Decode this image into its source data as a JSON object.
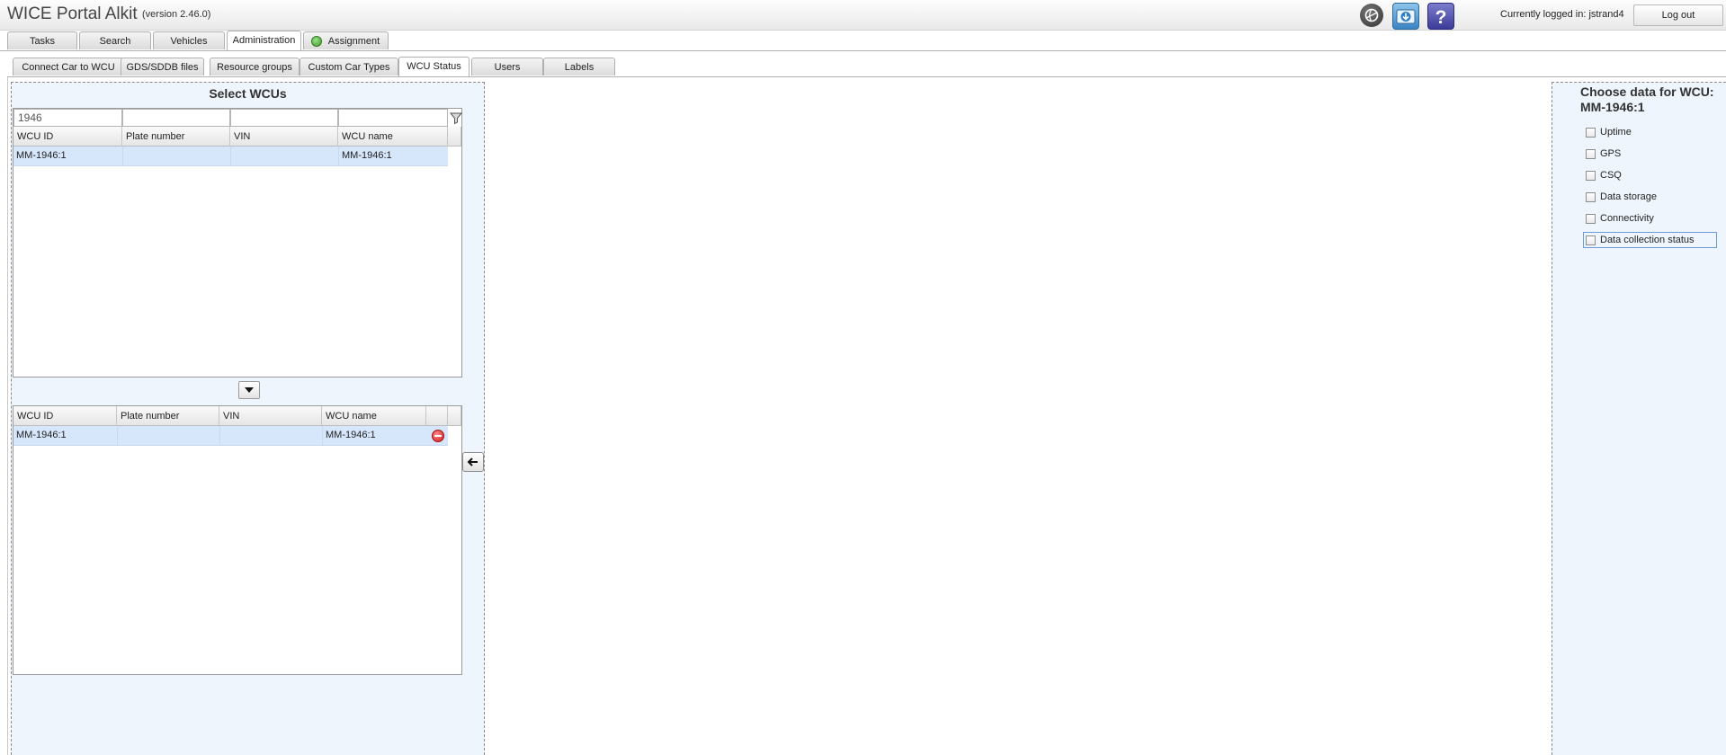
{
  "header": {
    "title": "WICE Portal Alkit",
    "version": "(version 2.46.0)",
    "icons": [
      "globe-icon",
      "download-icon",
      "help-icon"
    ],
    "login_text": "Currently logged in: jstrand4",
    "logout_label": "Log out"
  },
  "main_tabs": [
    {
      "label": "Tasks"
    },
    {
      "label": "Search"
    },
    {
      "label": "Vehicles"
    },
    {
      "label": "Administration",
      "active": true
    },
    {
      "label": "Assignment"
    }
  ],
  "sub_tabs": [
    {
      "label": "Connect Car to WCU"
    },
    {
      "label": "GDS/SDDB files"
    },
    {
      "label": "Resource groups"
    },
    {
      "label": "Custom Car Types"
    },
    {
      "label": "WCU Status",
      "active": true
    },
    {
      "label": "Users"
    },
    {
      "label": "Labels"
    }
  ],
  "left_panel": {
    "title": "Select WCUs",
    "filter_value": "1946",
    "top_grid": {
      "columns": [
        "WCU ID",
        "Plate number",
        "VIN",
        "WCU name"
      ],
      "rows": [
        {
          "wcu_id": "MM-1946:1",
          "plate": "",
          "vin": "",
          "name": "MM-1946:1"
        }
      ]
    },
    "bottom_grid": {
      "columns": [
        "WCU ID",
        "Plate number",
        "VIN",
        "WCU name"
      ],
      "rows": [
        {
          "wcu_id": "MM-1946:1",
          "plate": "",
          "vin": "",
          "name": "MM-1946:1"
        }
      ]
    }
  },
  "right_panel": {
    "title": "Choose data for WCU: MM-1946:1",
    "options": [
      {
        "label": "Uptime",
        "checked": false
      },
      {
        "label": "GPS",
        "checked": false
      },
      {
        "label": "CSQ",
        "checked": false
      },
      {
        "label": "Data storage",
        "checked": false
      },
      {
        "label": "Connectivity",
        "checked": false
      },
      {
        "label": "Data collection status",
        "checked": false,
        "focused": true
      }
    ]
  },
  "colors": {
    "panel_bg": "#eef5fd",
    "selected_row": "#d6e6fb",
    "remove_icon": "#d31c1c"
  }
}
